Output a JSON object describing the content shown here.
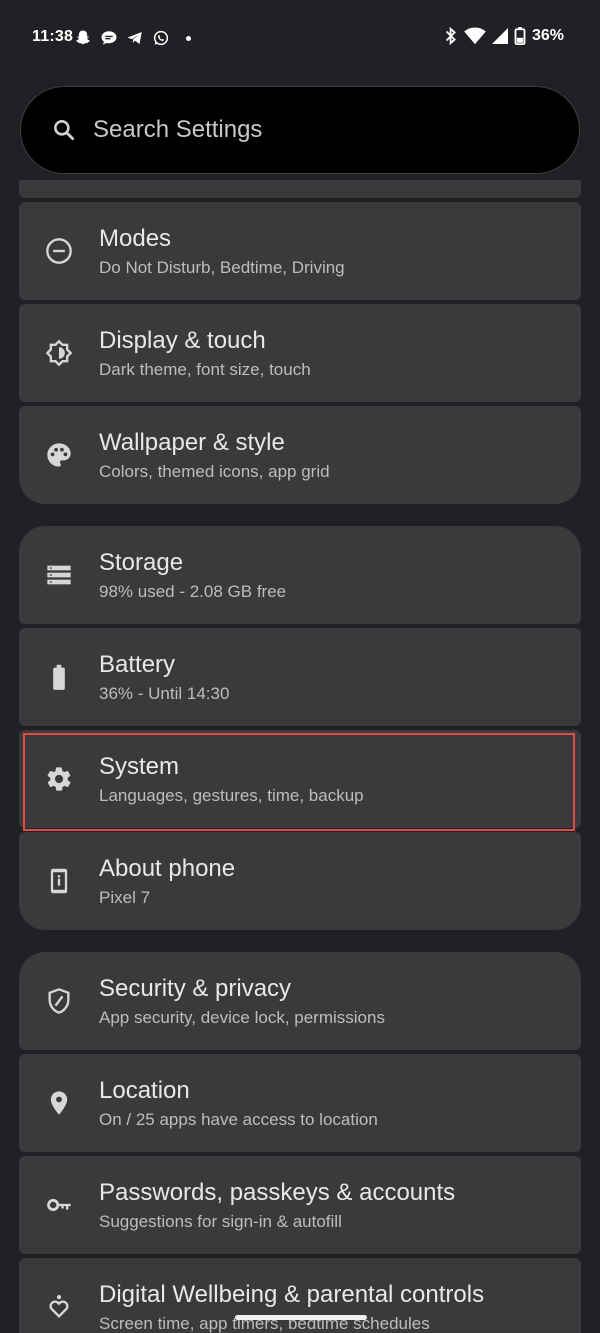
{
  "status_bar": {
    "time": "11:38",
    "notification_icons": [
      "snapchat-icon",
      "chat-bubble-icon",
      "telegram-icon",
      "whatsapp-icon"
    ],
    "system_icons": [
      "bluetooth-icon",
      "wifi-icon",
      "cell-signal-icon",
      "battery-icon"
    ],
    "battery_percent": "36%"
  },
  "search": {
    "placeholder": "Search Settings",
    "icon": "search-icon"
  },
  "groups": [
    {
      "items": [
        {
          "id": "modes",
          "icon": "do-not-disturb-icon",
          "title": "Modes",
          "subtitle": "Do Not Disturb, Bedtime, Driving"
        },
        {
          "id": "display",
          "icon": "brightness-icon",
          "title": "Display & touch",
          "subtitle": "Dark theme, font size, touch"
        },
        {
          "id": "wallpaper",
          "icon": "palette-icon",
          "title": "Wallpaper & style",
          "subtitle": "Colors, themed icons, app grid"
        }
      ]
    },
    {
      "items": [
        {
          "id": "storage",
          "icon": "storage-icon",
          "title": "Storage",
          "subtitle": "98% used - 2.08 GB free"
        },
        {
          "id": "battery",
          "icon": "battery-icon",
          "title": "Battery",
          "subtitle": "36% - Until 14:30"
        },
        {
          "id": "system",
          "icon": "gear-icon",
          "title": "System",
          "subtitle": "Languages, gestures, time, backup"
        },
        {
          "id": "about",
          "icon": "phone-info-icon",
          "title": "About phone",
          "subtitle": "Pixel 7"
        }
      ]
    },
    {
      "items": [
        {
          "id": "security",
          "icon": "shield-icon",
          "title": "Security & privacy",
          "subtitle": "App security, device lock, permissions"
        },
        {
          "id": "location",
          "icon": "location-pin-icon",
          "title": "Location",
          "subtitle": "On / 25 apps have access to location"
        },
        {
          "id": "passwords",
          "icon": "key-icon",
          "title": "Passwords, passkeys & accounts",
          "subtitle": "Suggestions for sign-in & autofill"
        },
        {
          "id": "wellbeing",
          "icon": "wellbeing-heart-icon",
          "title": "Digital Wellbeing & parental controls",
          "subtitle": "Screen time, app timers, bedtime schedules"
        }
      ]
    }
  ],
  "highlight_color": "#e14b43",
  "background_color": "#202124",
  "card_color": "#3a3a3c"
}
